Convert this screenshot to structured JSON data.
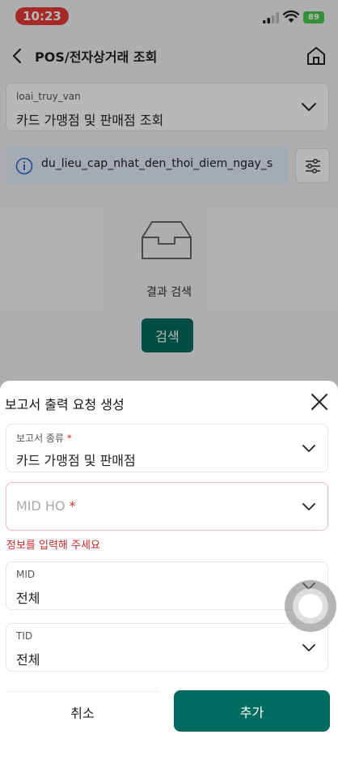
{
  "status_bar": {
    "time": "10:23",
    "battery": "89"
  },
  "header": {
    "title": "POS/전자상거래 조회"
  },
  "query_select": {
    "label": "loai_truy_van",
    "value": "카드 가맹점 및 판매점 조회"
  },
  "info": {
    "text": "du_lieu_cap_nhat_den_thoi_diem_ngay_s"
  },
  "empty_state": {
    "text": "결과 검색",
    "search_button": "검색"
  },
  "sheet": {
    "title": "보고서 출력 요청 생성",
    "report_type": {
      "label": "보고서 종류",
      "value": "카드 가맹점 및 판매점"
    },
    "mid_ho": {
      "placeholder": "MID HO",
      "error": "정보를 입력해 주세요"
    },
    "mid": {
      "label": "MID",
      "value": "전체"
    },
    "tid": {
      "label": "TID",
      "value": "전체"
    },
    "required_mark": "*",
    "cancel_label": "취소",
    "add_label": "추가"
  },
  "colors": {
    "primary": "#006b5f",
    "error": "#c62828",
    "time_pill": "#e53935",
    "info_bg": "#e4eefb"
  }
}
